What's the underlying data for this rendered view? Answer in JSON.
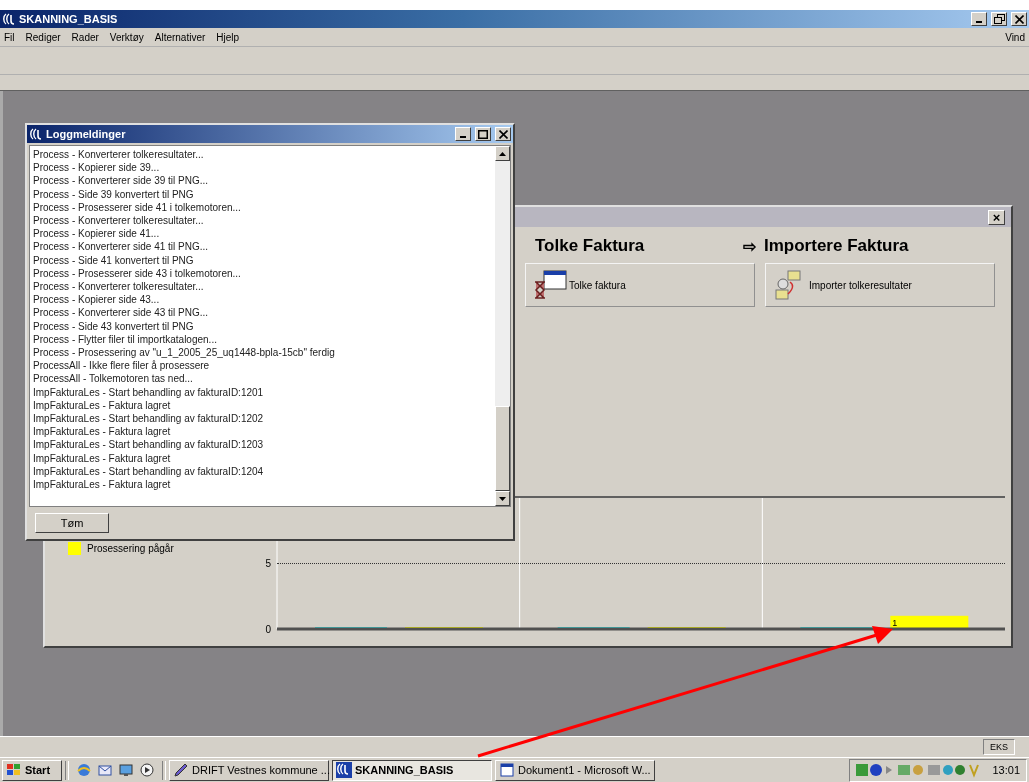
{
  "window": {
    "title": "SKANNING_BASIS",
    "menu": [
      "Fil",
      "Rediger",
      "Rader",
      "Verktøy",
      "Alternativer",
      "Hjelp"
    ],
    "menu_right": "Vind"
  },
  "process_window": {
    "close": "×",
    "steps": [
      {
        "title": "Tolke Faktura",
        "button": "Tolke faktura"
      },
      {
        "arrow": "⇨",
        "title": "Importere Faktura",
        "button": "Importer tolkeresultater"
      }
    ],
    "chart_data": {
      "type": "bar",
      "ylim": [
        0,
        10
      ],
      "yticks": [
        0,
        5
      ],
      "value_labels": [
        [
          null,
          null,
          null
        ],
        [
          null,
          null,
          "1"
        ]
      ],
      "series": [
        {
          "color": "#33dddd",
          "values": [
            0,
            0,
            0
          ]
        },
        {
          "name": "Prosessering pågår",
          "color": "#ffff00",
          "values": [
            0,
            0,
            1
          ]
        }
      ]
    }
  },
  "log_window": {
    "title": "Loggmeldinger",
    "lines": [
      "Process - Konverterer tolkeresultater...",
      "Process - Kopierer side 39...",
      "Process - Konverterer side 39 til PNG...",
      "Process - Side 39 konvertert til PNG",
      "Process - Prosesserer side 41 i tolkemotoren...",
      "Process - Konverterer tolkeresultater...",
      "Process - Kopierer side 41...",
      "Process - Konverterer side 41 til PNG...",
      "Process - Side 41 konvertert til PNG",
      "Process - Prosesserer side 43 i tolkemotoren...",
      "Process - Konverterer tolkeresultater...",
      "Process - Kopierer side 43...",
      "Process - Konverterer side 43 til PNG...",
      "Process - Side 43 konvertert til PNG",
      "Process - Flytter filer til importkatalogen...",
      "Process - Prosessering av \"u_1_2005_25_uq1448-bpla-15cb\" ferdig",
      "ProcessAll - Ikke flere filer å prosessere",
      "ProcessAll - Tolkemotoren tas ned...",
      "ImpFakturaLes - Start behandling av fakturaID:1201",
      "ImpFakturaLes - Faktura lagret",
      "ImpFakturaLes - Start behandling av fakturaID:1202",
      "ImpFakturaLes - Faktura lagret",
      "ImpFakturaLes - Start behandling av fakturaID:1203",
      "ImpFakturaLes - Faktura lagret",
      "ImpFakturaLes - Start behandling av fakturaID:1204",
      "ImpFakturaLes - Faktura lagret"
    ],
    "button": "Tøm"
  },
  "status_bar": {
    "indicator": "EKS"
  },
  "taskbar": {
    "start": "Start",
    "tasks": [
      {
        "label": "DRIFT Vestnes kommune ...",
        "selected": false
      },
      {
        "label": "SKANNING_BASIS",
        "selected": true
      },
      {
        "label": "Dokument1 - Microsoft W...",
        "selected": false
      }
    ],
    "clock": "13:01"
  }
}
